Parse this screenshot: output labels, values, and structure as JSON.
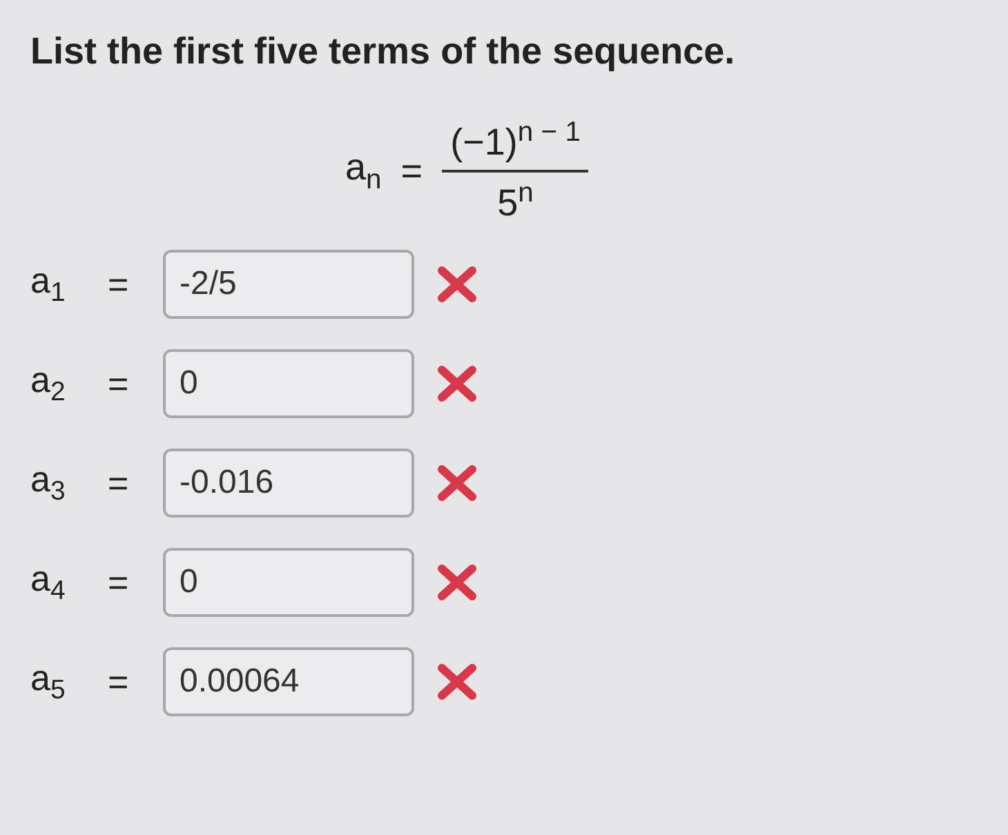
{
  "question": "List the first five terms of the sequence.",
  "formula": {
    "lhs": "a$_{n}$",
    "equals": "=",
    "numerator": "(−1)$^{n − 1}$",
    "denominator": "5$^{n}$"
  },
  "answers": [
    {
      "label": "a$_{1}$",
      "equals": "=",
      "value": "-2/5",
      "incorrect": true
    },
    {
      "label": "a$_{2}$",
      "equals": "=",
      "value": "0",
      "incorrect": true
    },
    {
      "label": "a$_{3}$",
      "equals": "=",
      "value": "-0.016",
      "incorrect": true
    },
    {
      "label": "a$_{4}$",
      "equals": "=",
      "value": "0",
      "incorrect": true
    },
    {
      "label": "a$_{5}$",
      "equals": "=",
      "value": "0.00064",
      "incorrect": true
    }
  ]
}
